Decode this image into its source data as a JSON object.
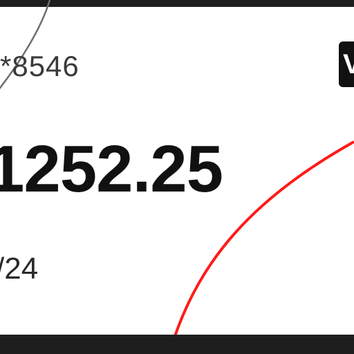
{
  "card": {
    "masked_number": "*8546",
    "balance": "1252.25",
    "expiry": "/24",
    "network_badge_label": "V"
  },
  "colors": {
    "frame": "#1e1e1e",
    "card_background": "#ffffff",
    "text_primary": "#111111",
    "decorative_arc_red": "#ff1a1a",
    "decorative_arc_gray": "#6e6e6e",
    "badge_background": "#111111"
  }
}
